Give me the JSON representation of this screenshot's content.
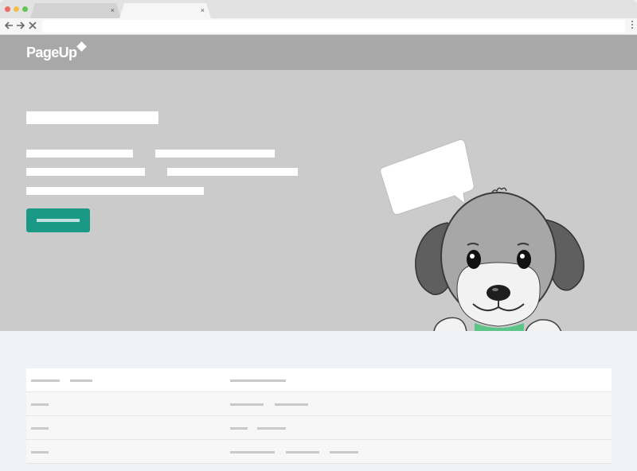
{
  "browser": {
    "tabs": [
      {
        "close_glyph": "×"
      },
      {
        "close_glyph": "×"
      }
    ],
    "url": ""
  },
  "site": {
    "logo_text": "PageUp",
    "brand_colors": {
      "header": "#a8a8a8",
      "hero": "#cbcbcb",
      "cta": "#1a9a86"
    }
  },
  "hero": {
    "illustration": "dog-mascot-with-speech-bubble",
    "cta_label": ""
  },
  "table": {
    "row_count": 4
  },
  "icons": [
    "back-arrow-icon",
    "forward-arrow-icon",
    "stop-icon",
    "menu-dots-icon",
    "speech-bubble-icon"
  ]
}
